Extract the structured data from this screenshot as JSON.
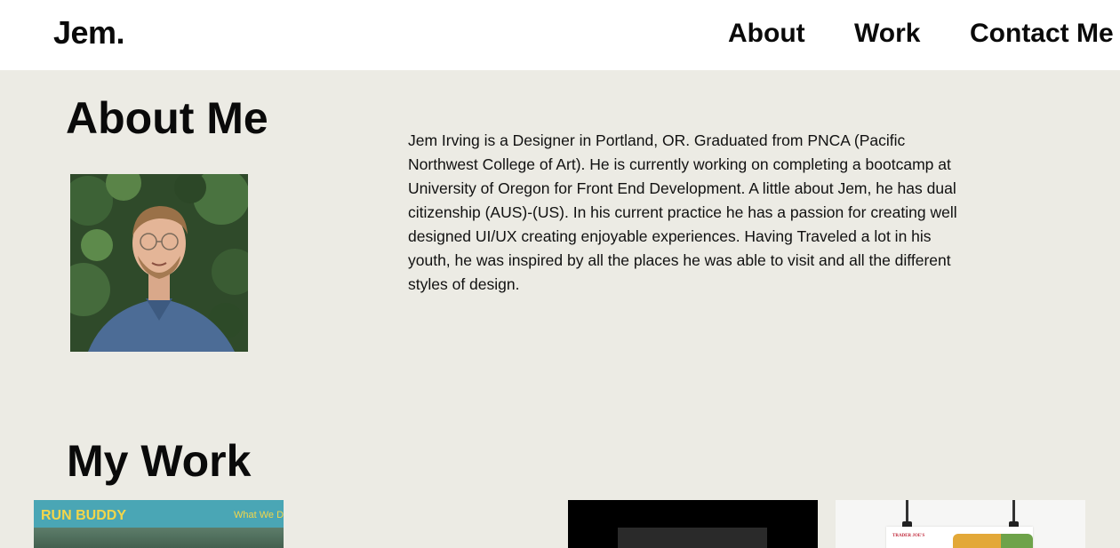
{
  "header": {
    "logo": "Jem.",
    "nav": {
      "about": "About",
      "work": "Work",
      "contact": "Contact Me"
    }
  },
  "about": {
    "title": "About Me",
    "bio": "Jem Irving is a Designer in Portland, OR. Graduated from PNCA (Pacific Northwest College of Art). He is currently working on completing a bootcamp at University of Oregon for Front End Development. A little about Jem, he has dual citizenship (AUS)-(US). In his current practice he has a passion for creating well designed UI/UX creating enjoyable experiences. Having Traveled a lot in his youth, he was inspired by all the places he was able to visit and all the different styles of design."
  },
  "work": {
    "title": "My Work",
    "projects": [
      {
        "title": "RUN BUDDY",
        "nav": "What We Do"
      },
      {
        "title": ""
      },
      {
        "title": "TRADER JOE'S"
      }
    ]
  },
  "colors": {
    "page_bg": "#ecebe4",
    "header_bg": "#ffffff",
    "runbuddy_bg": "#4aa6b5",
    "runbuddy_text": "#f3d64a"
  }
}
